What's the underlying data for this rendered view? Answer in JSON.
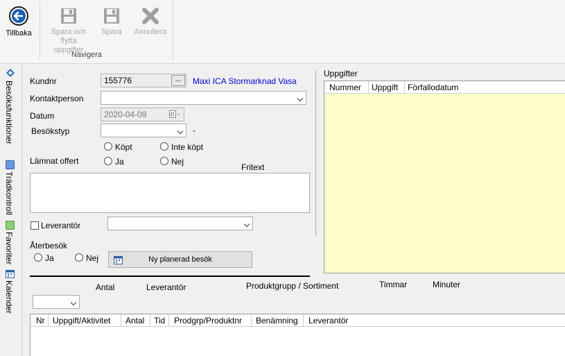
{
  "ribbon": {
    "back_label": "Tillbaka",
    "save_move_label": "Spara och\nflytta uppgifter",
    "save_label": "Spara",
    "cancel_label": "Annullera",
    "group_label": "Navigera"
  },
  "side_tabs": [
    "Besöksfunktioner",
    "Trädkontroll",
    "Favoriter",
    "Kalender"
  ],
  "form": {
    "kundnr_label": "Kundnr",
    "kundnr_value": "155776",
    "browse_label": "...",
    "customer_name": "Maxi ICA Stormarknad Vasa",
    "kontakt_label": "Kontaktperson",
    "kontakt_value": "",
    "datum_label": "Datum",
    "datum_value": "2020-04-09",
    "besokstyp_label": "Besökstyp",
    "besokstyp_value": "",
    "besokstyp_suffix": "-",
    "kopt_label": "Köpt",
    "inte_kopt_label": "Inte köpt",
    "offert_label": "Lämnat offert",
    "ja_label": "Ja",
    "nej_label": "Nej",
    "fritext_label": "Fritext",
    "fritext_value": "",
    "leverantor_label": "Leverantör",
    "aterbesok_label": "Återbesök",
    "aterbesok_ja": "Ja",
    "aterbesok_nej": "Nej",
    "ny_planerad_label": "Ny planerad besök"
  },
  "uppgifter": {
    "title": "Uppgifter",
    "columns": [
      "Nummer",
      "Uppgift",
      "Förfallodatum"
    ],
    "rows": []
  },
  "entry": {
    "headers": [
      "Antal",
      "Leverantör",
      "Produktgrupp / Sortiment",
      "Timmar",
      "Minuter"
    ]
  },
  "bottom_grid": {
    "columns": [
      "Nr",
      "Uppgift/Aktivitet",
      "Antal",
      "Tid",
      "Prodgrp/Produktnr",
      "Benämning",
      "Leverantör"
    ],
    "rows": []
  },
  "colors": {
    "accent_blue": "#1a5fb4",
    "link_blue": "#0000cc",
    "tasks_bg": "#ffffcc"
  }
}
